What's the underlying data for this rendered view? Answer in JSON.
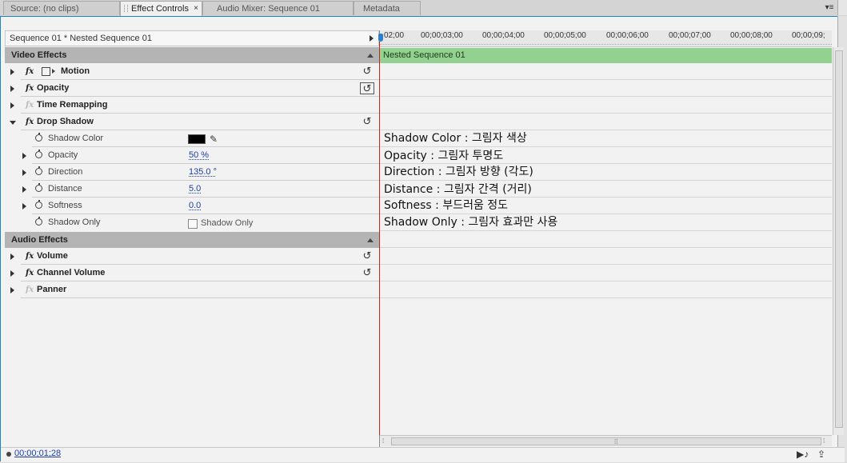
{
  "tabs": [
    {
      "label": "Source: (no clips)",
      "active": false
    },
    {
      "label": "Effect Controls",
      "active": true
    },
    {
      "label": "Audio Mixer: Sequence 01",
      "active": false
    },
    {
      "label": "Metadata",
      "active": false
    }
  ],
  "tab_close": "×",
  "panel_menu_icon": "▾≡",
  "sequence_path": "Sequence 01 * Nested Sequence 01",
  "video_section": "Video Effects",
  "audio_section": "Audio Effects",
  "fx_glyph": "fx",
  "reset_glyph": "↺",
  "video_effects": [
    {
      "name": "Motion"
    },
    {
      "name": "Opacity"
    },
    {
      "name": "Time Remapping"
    },
    {
      "name": "Drop Shadow"
    }
  ],
  "drop_shadow_params": [
    {
      "name": "Shadow Color",
      "value": ""
    },
    {
      "name": "Opacity",
      "value": "50 %"
    },
    {
      "name": "Direction",
      "value": "135.0 °"
    },
    {
      "name": "Distance",
      "value": "5.0"
    },
    {
      "name": "Softness",
      "value": "0.0"
    },
    {
      "name": "Shadow Only",
      "value": "Shadow Only"
    }
  ],
  "audio_effects": [
    {
      "name": "Volume"
    },
    {
      "name": "Channel Volume"
    },
    {
      "name": "Panner"
    }
  ],
  "ruler_ticks": [
    "02;00",
    "00;00;03;00",
    "00;00;04;00",
    "00;00;05;00",
    "00;00;06;00",
    "00;00;07;00",
    "00;00;08;00",
    "00;00;09;"
  ],
  "clip_name": "Nested Sequence 01",
  "annotations": [
    "Shadow Color : 그림자 색상",
    "Opacity : 그림자 투명도",
    "Direction : 그림자 방향 (각도)",
    "Distance : 그림자 간격 (거리)",
    "Softness : 부드러움 정도",
    "Shadow Only : 그림자 효과만 사용"
  ],
  "current_time": "00;00;01;28",
  "colors": {
    "accent": "#1b84c9",
    "clip": "#92d18f",
    "playhead": "#d02020",
    "section": "#b4b4b4",
    "link": "#1d3fa5"
  },
  "icons": {
    "play_audio": "▶♪",
    "export": "⇪",
    "dropper": "✎"
  }
}
